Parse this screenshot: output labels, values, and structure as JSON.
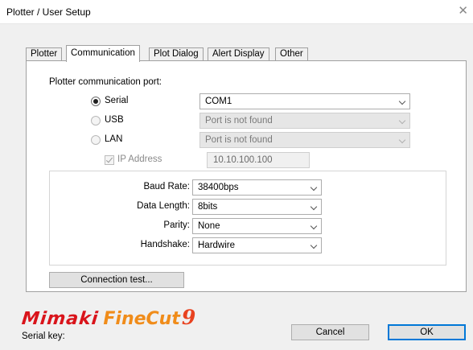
{
  "window": {
    "title": "Plotter / User Setup",
    "close_glyph": "✕"
  },
  "tabs": [
    {
      "label": "Plotter",
      "active": false
    },
    {
      "label": "Communication",
      "active": true
    },
    {
      "label": "Plot Dialog",
      "active": false
    },
    {
      "label": "Alert Display",
      "active": false
    },
    {
      "label": "Other",
      "active": false
    }
  ],
  "communication": {
    "port_heading": "Plotter communication port:",
    "serial": {
      "label": "Serial",
      "selected": true,
      "value": "COM1"
    },
    "usb": {
      "label": "USB",
      "selected": false,
      "value": "Port is not found"
    },
    "lan": {
      "label": "LAN",
      "selected": false,
      "value": "Port is not found"
    },
    "ip": {
      "label": "IP Address",
      "checked": true,
      "value": "10.10.100.100"
    },
    "settings": {
      "baud_rate": {
        "label": "Baud Rate:",
        "value": "38400bps"
      },
      "data_length": {
        "label": "Data Length:",
        "value": "8bits"
      },
      "parity": {
        "label": "Parity:",
        "value": "None"
      },
      "handshake": {
        "label": "Handshake:",
        "value": "Hardwire"
      }
    },
    "connection_test_label": "Connection test..."
  },
  "footer": {
    "logo_brand": "Mimaki",
    "logo_product": "FineCut",
    "logo_version": "9",
    "serial_key_label": "Serial key:",
    "cancel_label": "Cancel",
    "ok_label": "OK"
  },
  "colors": {
    "brand_red": "#d9141b",
    "brand_orange": "#f08c1a",
    "focus_blue": "#0078d7"
  }
}
